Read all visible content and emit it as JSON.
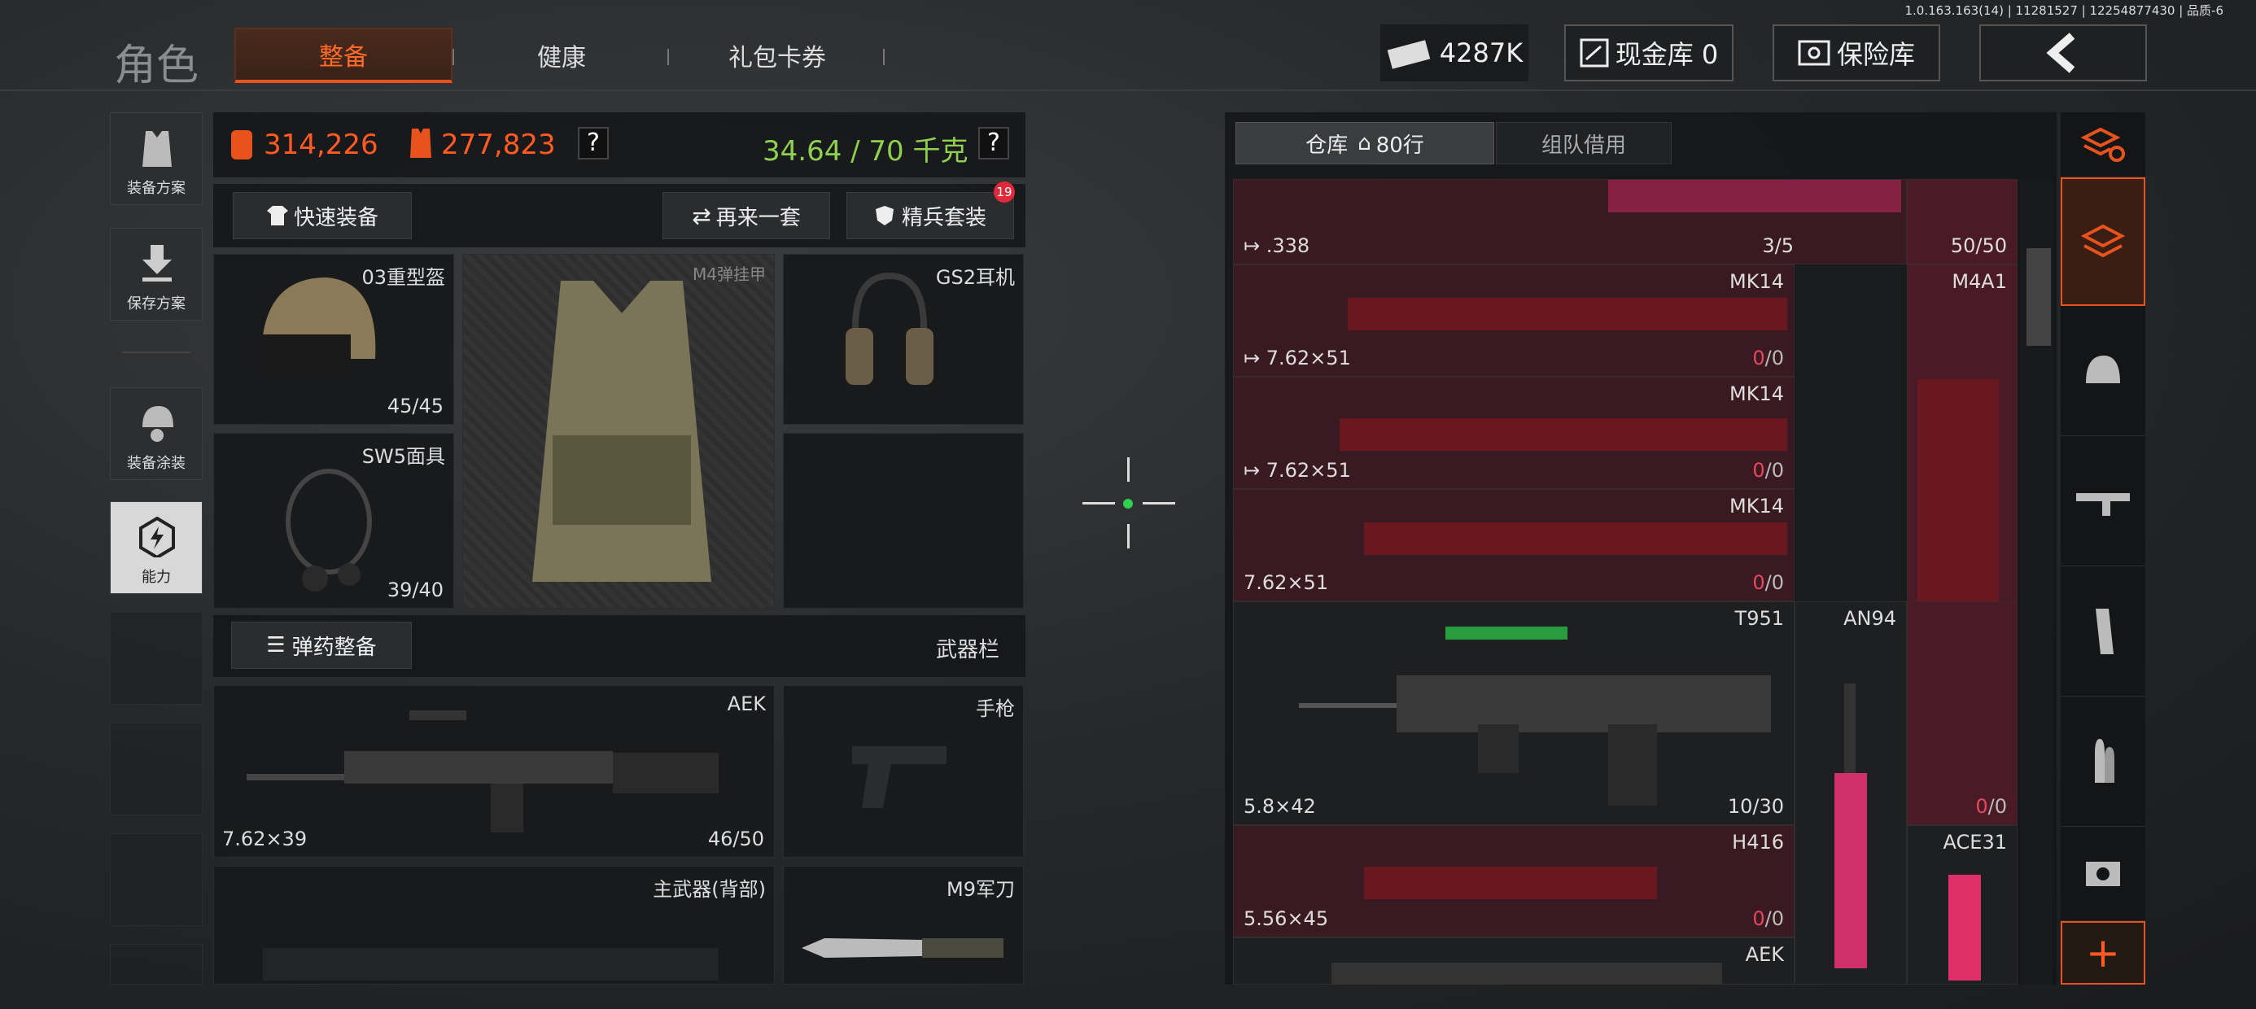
{
  "version": "1.0.163.163(14) | 11281527 | 12254877430 | 品质-6",
  "header": {
    "title": "角色",
    "tabs": [
      {
        "label": "整备",
        "active": true
      },
      {
        "label": "健康"
      },
      {
        "label": "礼包卡券"
      }
    ],
    "money": "4287K",
    "cash_vault": "现金库 0",
    "insurance": "保险库"
  },
  "loadout": {
    "value1": "314,226",
    "value2": "277,823",
    "help1": "?",
    "weight": "34.64 / 70 千克",
    "help2": "?"
  },
  "left_menu": [
    {
      "label": "装备方案",
      "icon": "vest-icon"
    },
    {
      "label": "保存方案",
      "icon": "download-icon"
    },
    {
      "label": "装备涂装",
      "icon": "helmet-paint-icon"
    },
    {
      "label": "能力",
      "icon": "ability-icon"
    }
  ],
  "buttons": {
    "quick_equip": "快速装备",
    "again": "再来一套",
    "elite": "精兵套装",
    "elite_badge": "19",
    "ammo": "弹药整备",
    "weapon_bar": "武器栏"
  },
  "slots": {
    "helmet": {
      "label": "03重型盔",
      "value": "45/45"
    },
    "armor": {
      "label": "M4弹挂甲"
    },
    "headset": {
      "label": "GS2耳机"
    },
    "mask": {
      "label": "SW5面具",
      "value": "39/40"
    },
    "primary": {
      "label": "AEK",
      "caliber": "7.62×39",
      "value": "46/50"
    },
    "pistol": {
      "label": "手枪"
    },
    "backup": {
      "label": "主武器(背部)"
    },
    "knife": {
      "label": "M9军刀"
    }
  },
  "storage": {
    "tab1": "仓库",
    "rows": "80行",
    "tab2": "组队借用"
  },
  "items": [
    {
      "cal": ".338",
      "name": "",
      "count": "3/5"
    },
    {
      "name": "",
      "count": "50/50"
    },
    {
      "cal": "7.62×51",
      "name": "MK14",
      "count_a": "0",
      "count_b": "/0"
    },
    {
      "name": "M4A1"
    },
    {
      "cal": "7.62×51",
      "name": "MK14",
      "count_a": "0",
      "count_b": "/0"
    },
    {
      "cal": "7.62×51",
      "name": "MK14",
      "count_a": "0",
      "count_b": "/0"
    },
    {
      "cal": "5.8×42",
      "name": "T951",
      "count": "10/30"
    },
    {
      "name": "AN94"
    },
    {
      "count_a": "0",
      "count_b": "/0"
    },
    {
      "cal": "5.56×45",
      "name": "H416",
      "count_a": "0",
      "count_b": "/0"
    },
    {
      "name": "ACE31"
    },
    {
      "name": "AEK"
    }
  ],
  "colors": {
    "accent": "#e8521d",
    "weight": "#8fd14f",
    "zero": "#e8465a"
  }
}
